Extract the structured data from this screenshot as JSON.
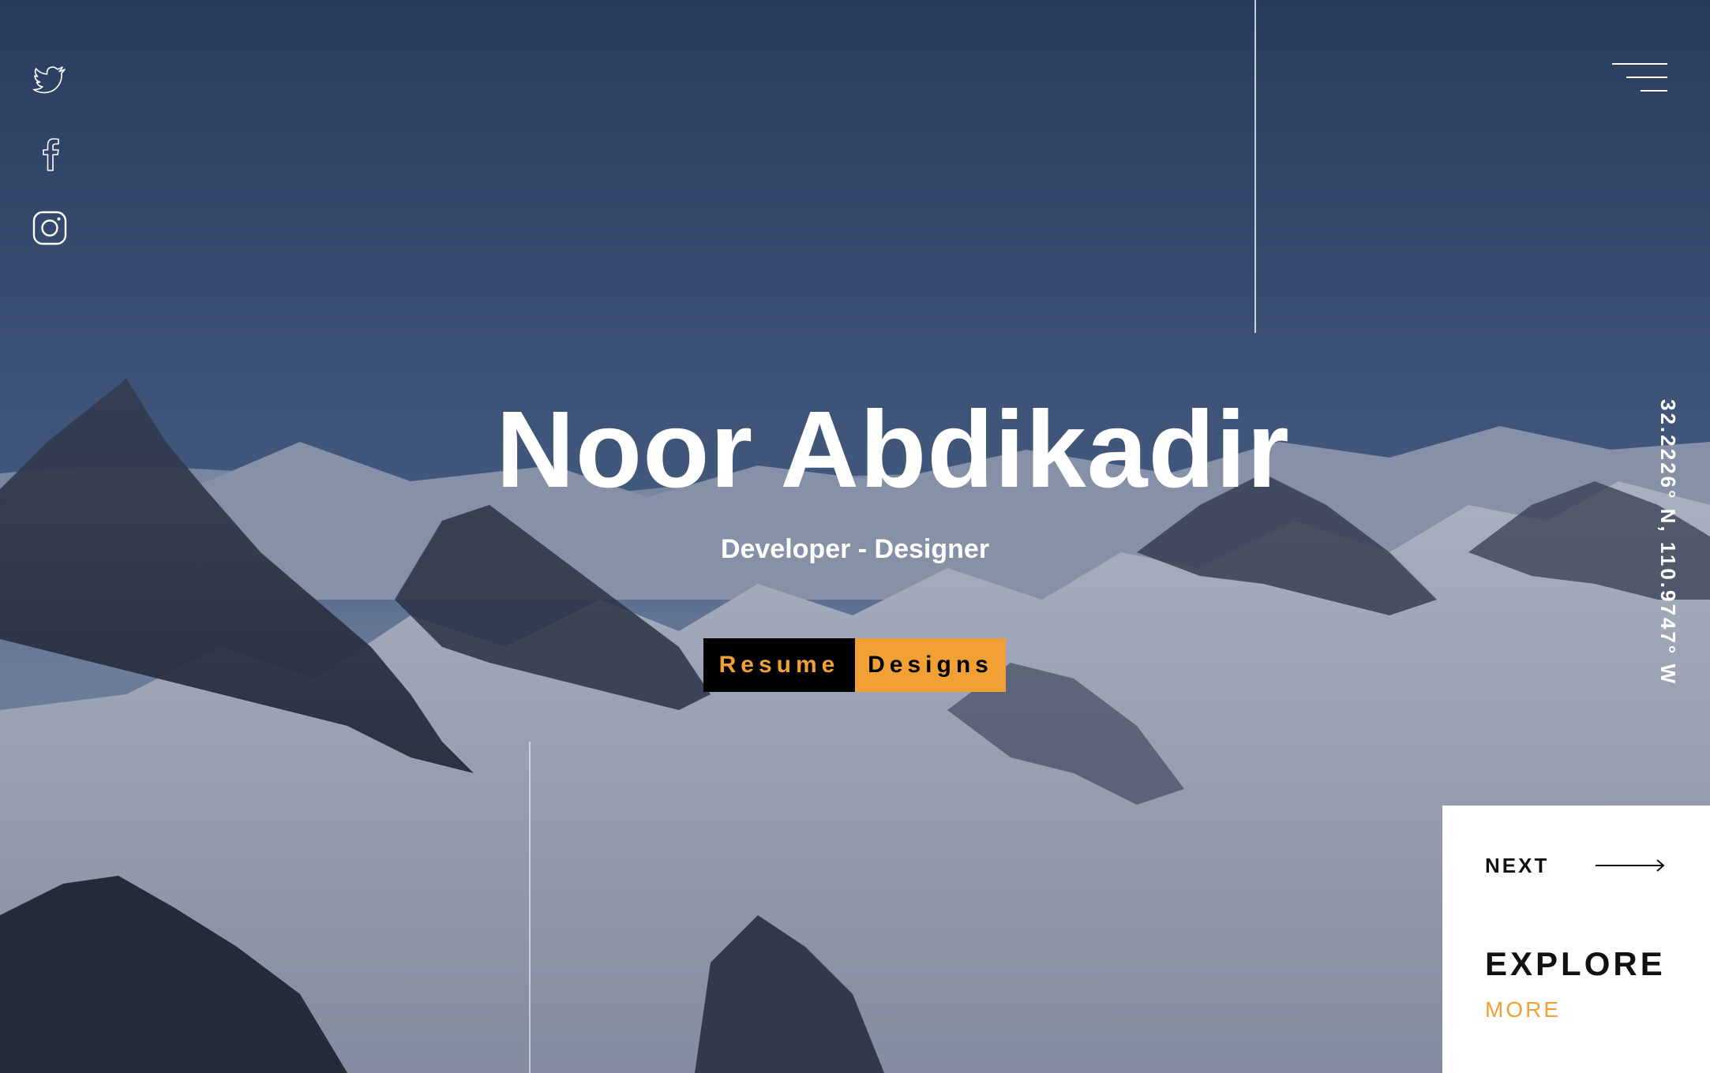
{
  "profile": {
    "name": "Noor Abdikadir",
    "tagline": "Developer - Designer"
  },
  "buttons": {
    "resume_label": "Resume",
    "designs_label": "Designs"
  },
  "social": [
    {
      "name": "twitter",
      "icon": "twitter-icon"
    },
    {
      "name": "facebook",
      "icon": "facebook-icon"
    },
    {
      "name": "instagram",
      "icon": "instagram-icon"
    }
  ],
  "menu": {
    "icon": "hamburger-menu-icon"
  },
  "coordinates": "32.2226° N, 110.9747° W",
  "next_panel": {
    "next_label": "NEXT",
    "arrow_icon": "arrow-right-icon",
    "explore_label": "EXPLORE",
    "more_label": "MORE"
  },
  "colors": {
    "accent": "#f0a034",
    "button_dark": "#000000",
    "text_light": "#ffffff",
    "panel_bg": "#ffffff"
  }
}
